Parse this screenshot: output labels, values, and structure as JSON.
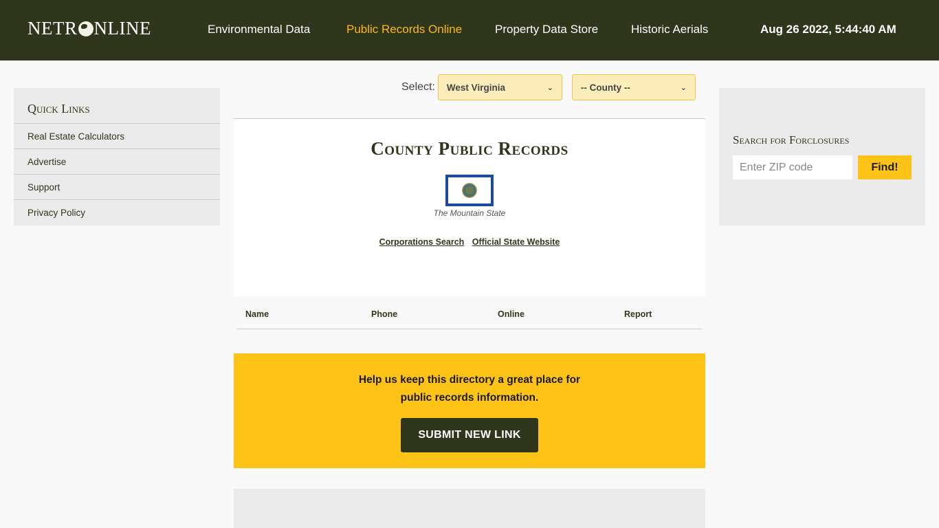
{
  "header": {
    "logo_prefix": "NETR",
    "logo_suffix": "NLINE",
    "nav": [
      {
        "label": "Environmental Data",
        "active": false
      },
      {
        "label": "Public Records Online",
        "active": true
      },
      {
        "label": "Property Data Store",
        "active": false
      },
      {
        "label": "Historic Aerials",
        "active": false
      }
    ],
    "datetime": "Aug 26 2022, 5:44:40 AM"
  },
  "colors": {
    "header_bg": "#30361c",
    "accent": "#f8b91c",
    "promo_bg": "#fdc317"
  },
  "selector": {
    "label": "Select:",
    "state_value": "West Virginia",
    "county_value": "-- County --"
  },
  "sidebar": {
    "title": "Quick Links",
    "items": [
      {
        "label": "Real Estate Calculators"
      },
      {
        "label": "Advertise"
      },
      {
        "label": "Support"
      },
      {
        "label": "Privacy Policy"
      }
    ]
  },
  "main": {
    "title": "County Public Records",
    "flag_icon": "west-virginia-flag",
    "motto": "The Mountain State",
    "links": [
      {
        "label": "Corporations Search"
      },
      {
        "label": "Official State Website"
      }
    ],
    "table_headers": [
      "Name",
      "Phone",
      "Online",
      "Report"
    ]
  },
  "promo": {
    "line1": "Help us keep this directory a great place for",
    "line2": "public records information.",
    "button_label": "SUBMIT NEW LINK"
  },
  "foreclosure": {
    "title": "Search for Forclosures",
    "placeholder": "Enter ZIP code",
    "button_label": "Find!"
  }
}
